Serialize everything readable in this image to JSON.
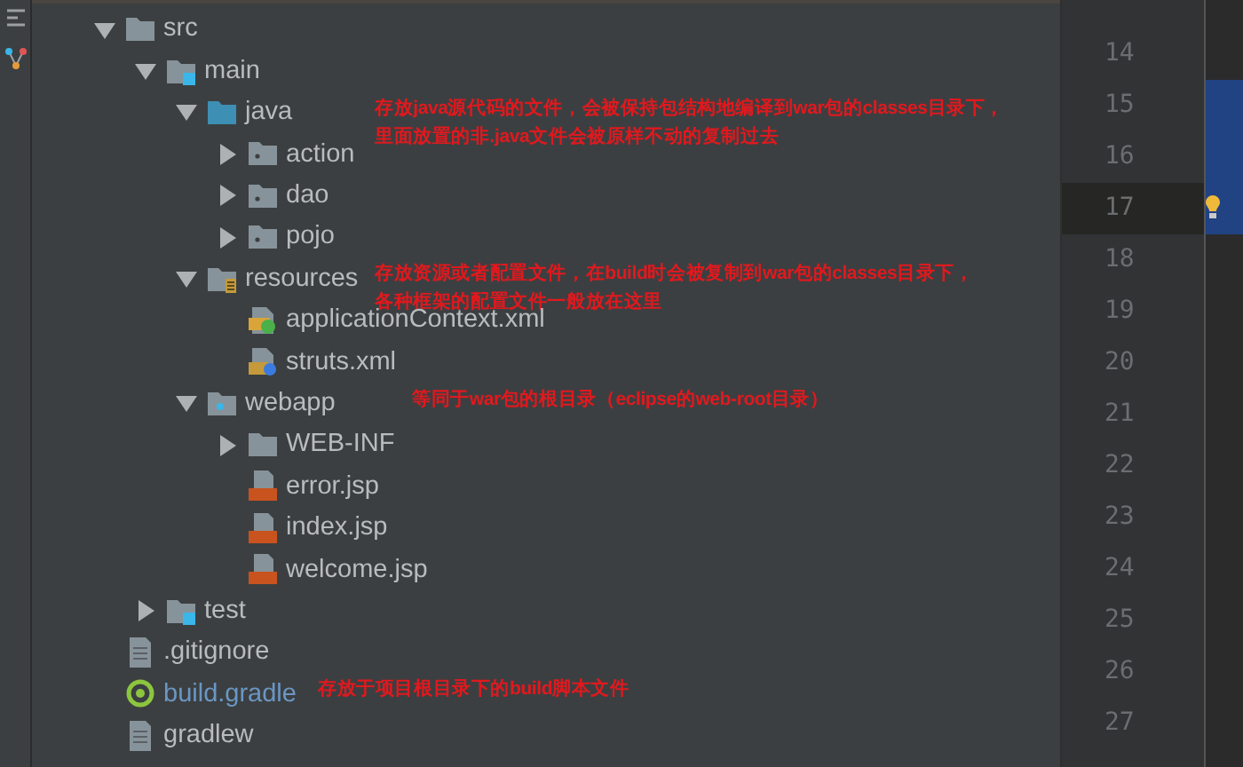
{
  "tree": [
    {
      "name": "src",
      "kind": "folder",
      "expanded": true,
      "children": [
        {
          "name": "main",
          "kind": "source_root",
          "expanded": true,
          "children": [
            {
              "name": "java",
              "kind": "source_folder",
              "expanded": true,
              "note": [
                "存放java源代码的文件，会被保持包结构地编译到war包的classes目录下，",
                "里面放置的非.java文件会被原样不动的复制过去"
              ],
              "children": [
                {
                  "name": "action",
                  "kind": "package",
                  "expanded": false
                },
                {
                  "name": "dao",
                  "kind": "package",
                  "expanded": false
                },
                {
                  "name": "pojo",
                  "kind": "package",
                  "expanded": false
                }
              ]
            },
            {
              "name": "resources",
              "kind": "resource_folder",
              "expanded": true,
              "note": [
                "存放资源或者配置文件，在build时会被复制到war包的classes目录下，",
                "各种框架的配置文件一般放在这里"
              ],
              "children": [
                {
                  "name": "applicationContext.xml",
                  "kind": "spring_xml"
                },
                {
                  "name": "struts.xml",
                  "kind": "struts_xml"
                }
              ]
            },
            {
              "name": "webapp",
              "kind": "web_folder",
              "expanded": true,
              "note": [
                "等同于war包的根目录（eclipse的web-root目录）"
              ],
              "children": [
                {
                  "name": "WEB-INF",
                  "kind": "folder",
                  "expanded": false
                },
                {
                  "name": "error.jsp",
                  "kind": "jsp"
                },
                {
                  "name": "index.jsp",
                  "kind": "jsp"
                },
                {
                  "name": "welcome.jsp",
                  "kind": "jsp"
                }
              ]
            }
          ]
        },
        {
          "name": "test",
          "kind": "source_root",
          "expanded": false
        }
      ]
    },
    {
      "name": ".gitignore",
      "kind": "text"
    },
    {
      "name": "build.gradle",
      "kind": "gradle",
      "modified": true,
      "note": [
        "存放于项目根目录下的build脚本文件"
      ]
    },
    {
      "name": "gradlew",
      "kind": "text"
    }
  ],
  "line_numbers": [
    {
      "number": "14",
      "current": false
    },
    {
      "number": "15",
      "current": false
    },
    {
      "number": "16",
      "current": false
    },
    {
      "number": "17",
      "current": true
    },
    {
      "number": "18",
      "current": false
    },
    {
      "number": "19",
      "current": false
    },
    {
      "number": "20",
      "current": false
    },
    {
      "number": "21",
      "current": false
    },
    {
      "number": "22",
      "current": false
    },
    {
      "number": "23",
      "current": false
    },
    {
      "number": "24",
      "current": false
    },
    {
      "number": "25",
      "current": false
    },
    {
      "number": "26",
      "current": false
    },
    {
      "number": "27",
      "current": false
    }
  ]
}
